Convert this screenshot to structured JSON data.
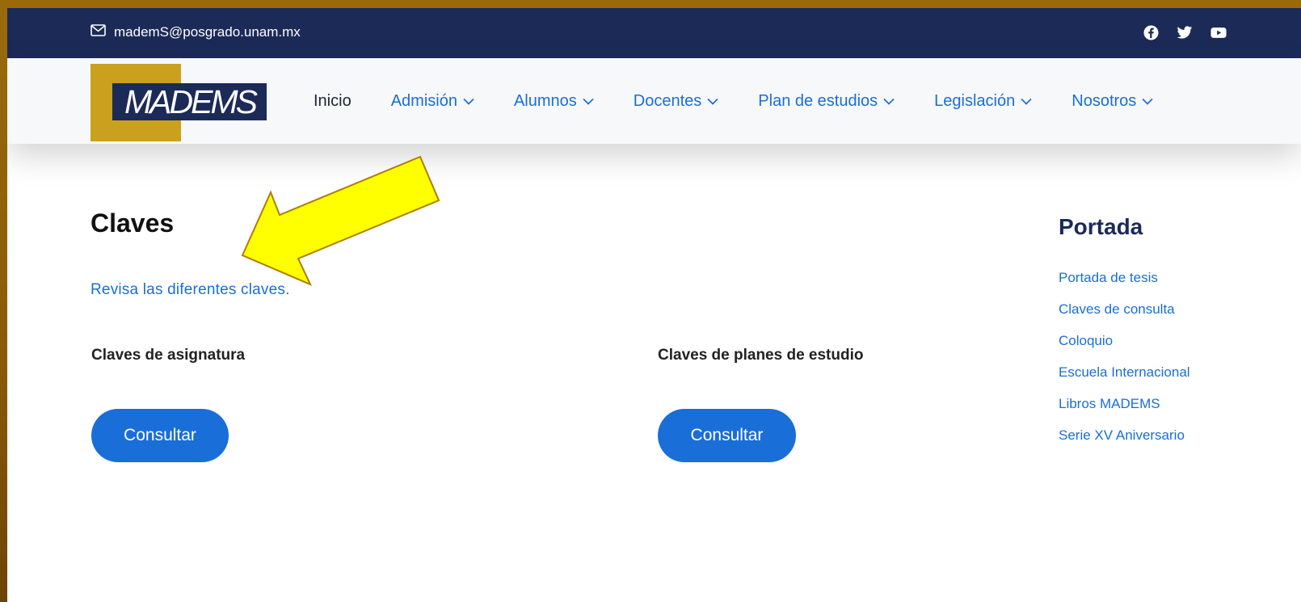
{
  "topbar": {
    "email": "mademS@posgrado.unam.mx",
    "social": [
      "facebook-icon",
      "twitter-icon",
      "youtube-icon"
    ]
  },
  "logo": {
    "text": "MADEMS"
  },
  "nav": [
    {
      "label": "Inicio",
      "dropdown": false
    },
    {
      "label": "Admisión",
      "dropdown": true
    },
    {
      "label": "Alumnos",
      "dropdown": true
    },
    {
      "label": "Docentes",
      "dropdown": true
    },
    {
      "label": "Plan de estudios",
      "dropdown": true
    },
    {
      "label": "Legislación",
      "dropdown": true
    },
    {
      "label": "Nosotros",
      "dropdown": true
    }
  ],
  "main": {
    "title": "Claves",
    "intro": "Revisa las diferentes claves.",
    "sections": [
      {
        "heading": "Claves de asignatura",
        "button": "Consultar"
      },
      {
        "heading": "Claves de planes de estudio",
        "button": "Consultar"
      }
    ]
  },
  "sidebar": {
    "title": "Portada",
    "items": [
      "Portada de tesis",
      "Claves de consulta",
      "Coloquio",
      "Escuela Internacional",
      "Libros MADEMS",
      "Serie XV Aniversario"
    ]
  },
  "colors": {
    "navy": "#1c2a58",
    "gold": "#c9a11e",
    "link_blue": "#1a6ed8",
    "arrow_yellow": "#ffff00"
  }
}
